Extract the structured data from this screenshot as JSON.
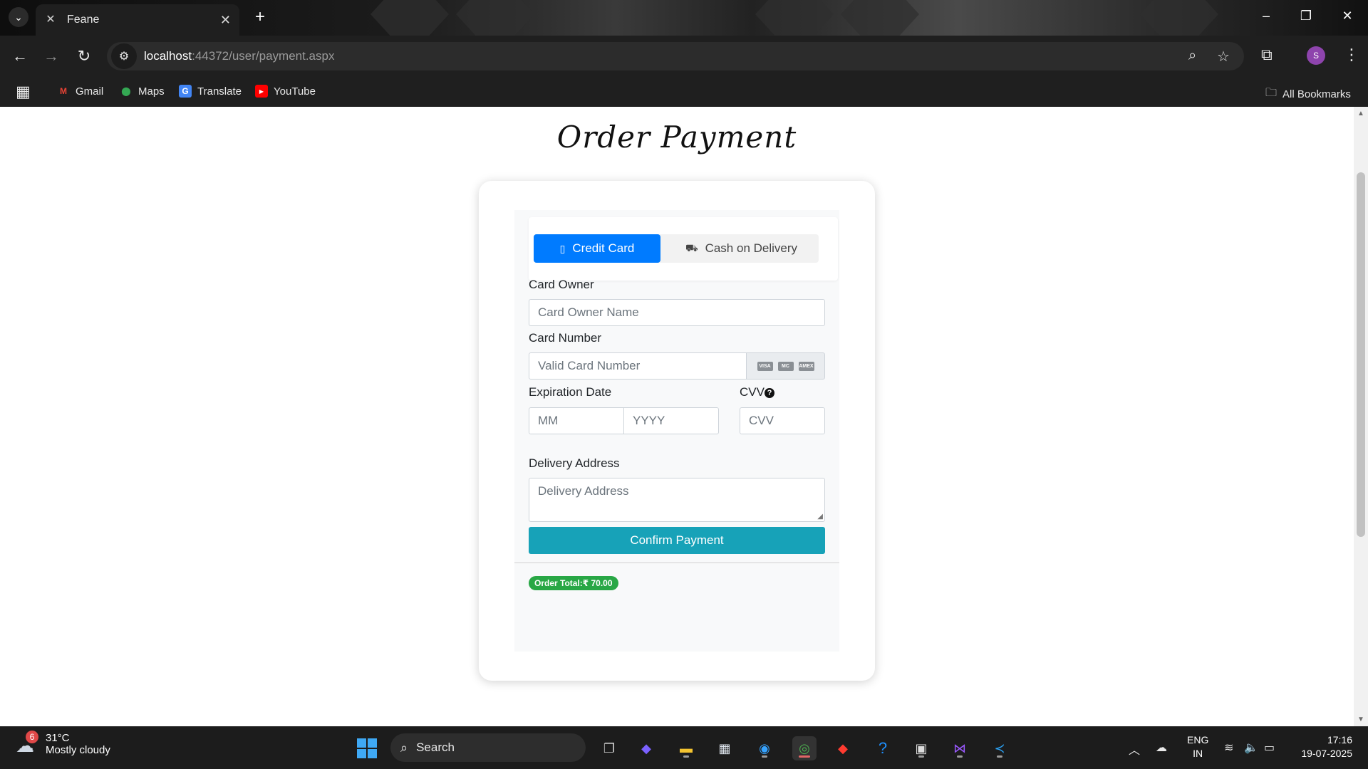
{
  "browser": {
    "tab_title": "Feane",
    "url_host": "localhost",
    "url_path": ":44372/user/payment.aspx",
    "profile_initial": "S",
    "bookmarks": [
      {
        "label": "Gmail",
        "icon": "gmail-icon",
        "color": "#ea4335"
      },
      {
        "label": "Maps",
        "icon": "maps-icon",
        "color": "#34a853"
      },
      {
        "label": "Translate",
        "icon": "translate-icon",
        "color": "#4285f4"
      },
      {
        "label": "YouTube",
        "icon": "youtube-icon",
        "color": "#ff0000"
      }
    ],
    "all_bookmarks": "All Bookmarks"
  },
  "page": {
    "title": "Order Payment",
    "tabs": {
      "credit_card": "Credit Card",
      "cash_on_delivery": "Cash on Delivery"
    },
    "form": {
      "card_owner_label": "Card Owner",
      "card_owner_placeholder": "Card Owner Name",
      "card_number_label": "Card Number",
      "card_number_placeholder": "Valid Card Number",
      "card_brands": [
        "VISA",
        "MC",
        "AMEX"
      ],
      "expiration_label": "Expiration Date",
      "month_placeholder": "MM",
      "year_placeholder": "YYYY",
      "cvv_label": "CVV",
      "cvv_placeholder": "CVV",
      "address_label": "Delivery Address",
      "address_placeholder": "Delivery Address",
      "confirm_button": "Confirm Payment"
    },
    "order_total": "Order Total:₹ 70.00",
    "colors": {
      "active_tab": "#007bff",
      "confirm_button": "#17a2b8",
      "total_badge": "#28a745"
    }
  },
  "taskbar": {
    "weather_badge": "6",
    "temperature": "31°C",
    "condition": "Mostly cloudy",
    "search_label": "Search",
    "language": "ENG",
    "region": "IN",
    "time": "17:16",
    "date": "19-07-2025"
  }
}
